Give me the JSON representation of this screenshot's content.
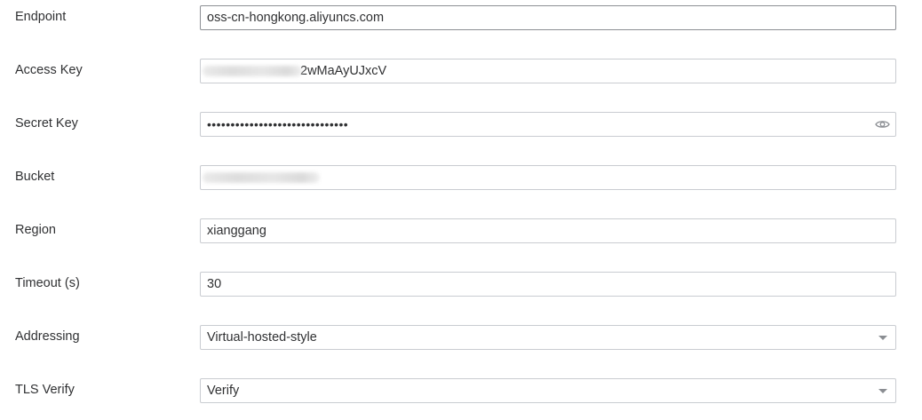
{
  "form": {
    "endpoint": {
      "label": "Endpoint",
      "value": "oss-cn-hongkong.aliyuncs.com"
    },
    "access_key": {
      "label": "Access Key",
      "value_visible_tail": "2wMaAyUJxcV"
    },
    "secret_key": {
      "label": "Secret Key",
      "value_masked": "••••••••••••••••••••••••••••••",
      "reveal_icon": "eye-icon"
    },
    "bucket": {
      "label": "Bucket"
    },
    "region": {
      "label": "Region",
      "value": "xianggang"
    },
    "timeout": {
      "label": "Timeout (s)",
      "value": "30"
    },
    "addressing": {
      "label": "Addressing",
      "selected": "Virtual-hosted-style",
      "icon": "caret-down-icon"
    },
    "tls_verify": {
      "label": "TLS Verify",
      "selected": "Verify",
      "icon": "caret-down-icon"
    }
  },
  "colors": {
    "text": "#303133",
    "border": "#c9ccd1",
    "border_active": "#8c8f94",
    "icon": "#8a8d92",
    "redaction": "#dcdcdc"
  }
}
